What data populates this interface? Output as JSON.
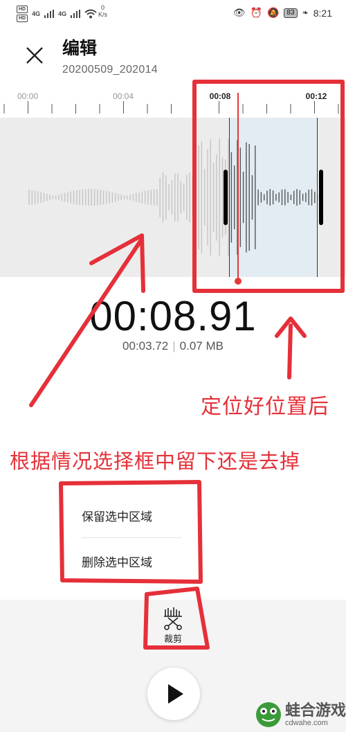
{
  "status_bar": {
    "hd_top": "HD",
    "hd_bottom": "HD",
    "net1": "4G",
    "net2": "4G",
    "speed_value": "0",
    "speed_unit": "K/s",
    "battery": "83",
    "time": "8:21"
  },
  "header": {
    "title": "编辑",
    "subtitle": "20200509_202014"
  },
  "ruler": {
    "labels": [
      "00:00",
      "00:04",
      "00:08",
      "00:12"
    ]
  },
  "playback": {
    "current_time": "00:08.91",
    "duration": "00:03.72",
    "size": "0.07 MB"
  },
  "annotations": {
    "position_note": "定位好位置后",
    "choose_note": "根据情况选择框中留下还是去掉"
  },
  "menu": {
    "keep": "保留选中区域",
    "delete": "删除选中区域"
  },
  "toolbar": {
    "crop_label": "裁剪"
  },
  "watermark": {
    "name": "蛙合游戏",
    "url": "cdwahe.com"
  },
  "colors": {
    "annotation_red": "#e53039",
    "playhead_red": "#e53935",
    "selection_fill": "#e2ecf2"
  }
}
